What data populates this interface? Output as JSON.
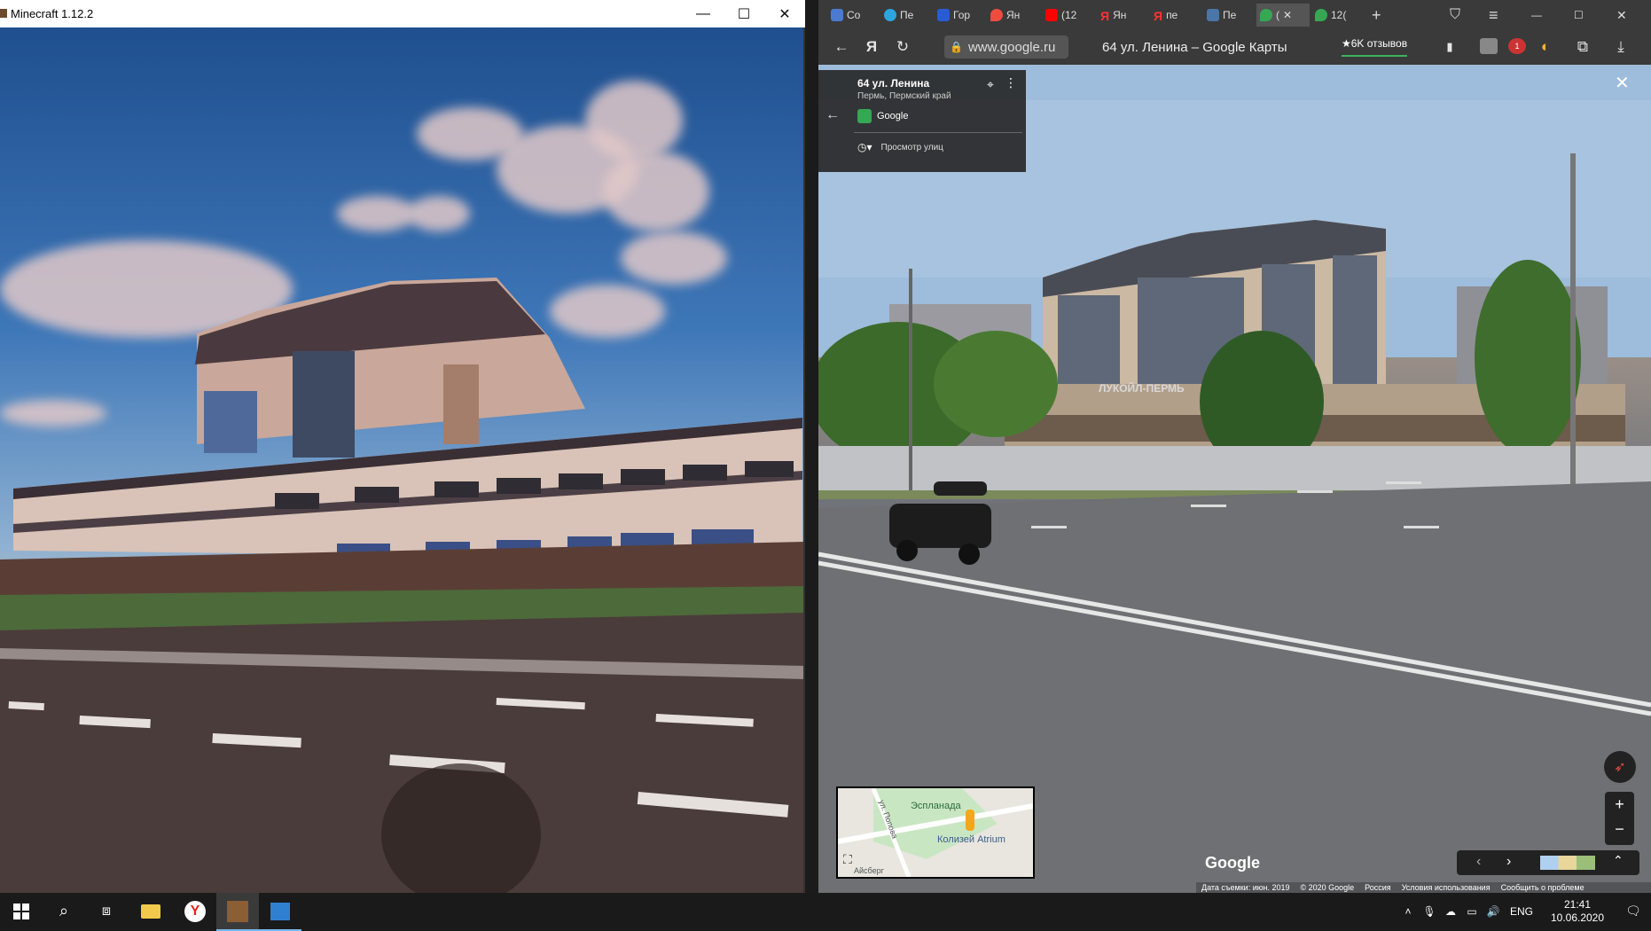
{
  "minecraft": {
    "title": "Minecraft 1.12.2",
    "buttons": {
      "minimize": "—",
      "maximize": "☐",
      "close": "✕"
    }
  },
  "browser": {
    "tabs": [
      {
        "label": "Co",
        "icon_color": "#4a7bd0"
      },
      {
        "label": "Пе",
        "icon_color": "#2ca5e0"
      },
      {
        "label": "Гор",
        "icon_color": "#2a5bd7"
      },
      {
        "label": "Ян",
        "icon_color": "#ef4b3f"
      },
      {
        "label": "(12",
        "icon_color": "#ff0000"
      },
      {
        "label": "Ян",
        "icon_color": "#ff3333"
      },
      {
        "label": "пе",
        "icon_color": "#ff3333"
      },
      {
        "label": "Пе",
        "icon_color": "#4a76a8"
      },
      {
        "label": "(",
        "icon_color": "#34a853"
      },
      {
        "label": "12(",
        "icon_color": "#34a853"
      }
    ],
    "new_tab": "+",
    "window_buttons": {
      "minimize": "—",
      "maximize": "☐",
      "close": "✕"
    },
    "toolbar": {
      "back": "←",
      "yandex": "Я",
      "reload": "↻",
      "url": "www.google.ru",
      "page_title": "64 ул. Ленина – Google Карты",
      "reviews": "★6K отзывов"
    },
    "extension_badge": "1",
    "place": {
      "name": "64 ул. Ленина",
      "region": "Пермь, Пермский край",
      "provider": "Google",
      "street_view": "Просмотр улиц"
    },
    "building_sign": "ЛУКОЙЛ-ПЕРМЬ",
    "minimap": {
      "label1": "Эспланада",
      "label2": "ул. Попова",
      "label3": "Колизей Atrium",
      "label4": "Айсберг"
    },
    "watermark": "Google",
    "zoom": {
      "plus": "+",
      "minus": "−"
    },
    "footer": [
      "Дата съемки: июн. 2019",
      "© 2020 Google",
      "Россия",
      "Условия использования",
      "Сообщить о проблеме"
    ]
  },
  "taskbar": {
    "language": "ENG",
    "time": "21:41",
    "date": "10.06.2020"
  }
}
